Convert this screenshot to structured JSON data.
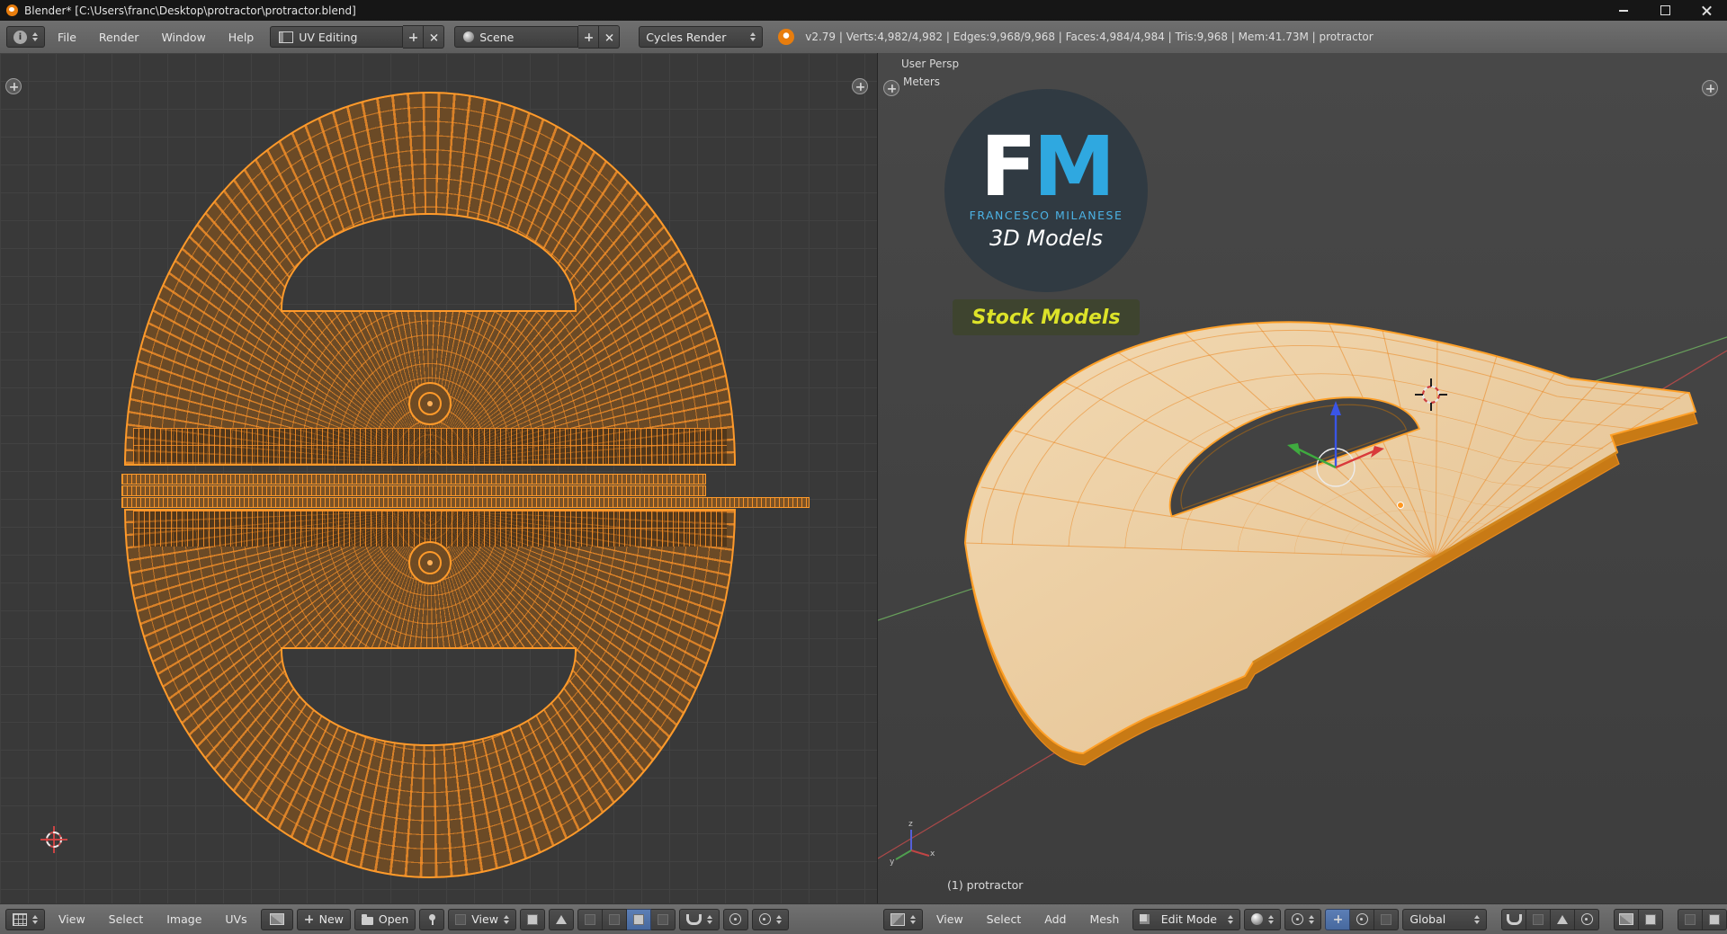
{
  "window": {
    "title": "Blender* [C:\\Users\\franc\\Desktop\\protractor\\protractor.blend]"
  },
  "icons": {
    "info": "i"
  },
  "info_bar": {
    "menus": [
      "File",
      "Render",
      "Window",
      "Help"
    ],
    "layout_name": "UV Editing",
    "scene_name": "Scene",
    "engine_name": "Cycles Render",
    "stats": "v2.79 | Verts:4,982/4,982 | Edges:9,968/9,968 | Faces:4,984/4,984 | Tris:9,968 | Mem:41.73M | protractor"
  },
  "uv_editor": {
    "menus": [
      "View",
      "Select",
      "Image",
      "UVs"
    ],
    "new_label": "New",
    "open_label": "Open",
    "pivot_label": "View"
  },
  "viewport": {
    "view_label": "User Persp",
    "units_label": "Meters",
    "object_label": "(1) protractor",
    "menus": [
      "View",
      "Select",
      "Add",
      "Mesh"
    ],
    "mode_label": "Edit Mode",
    "orientation_label": "Global",
    "axis": {
      "x": "x",
      "y": "y",
      "z": "z"
    },
    "logo": {
      "letter_f": "F",
      "letter_m": "M",
      "name": "FRANCESCO MILANESE",
      "tagline": "3D Models",
      "badge": "Stock Models"
    }
  }
}
